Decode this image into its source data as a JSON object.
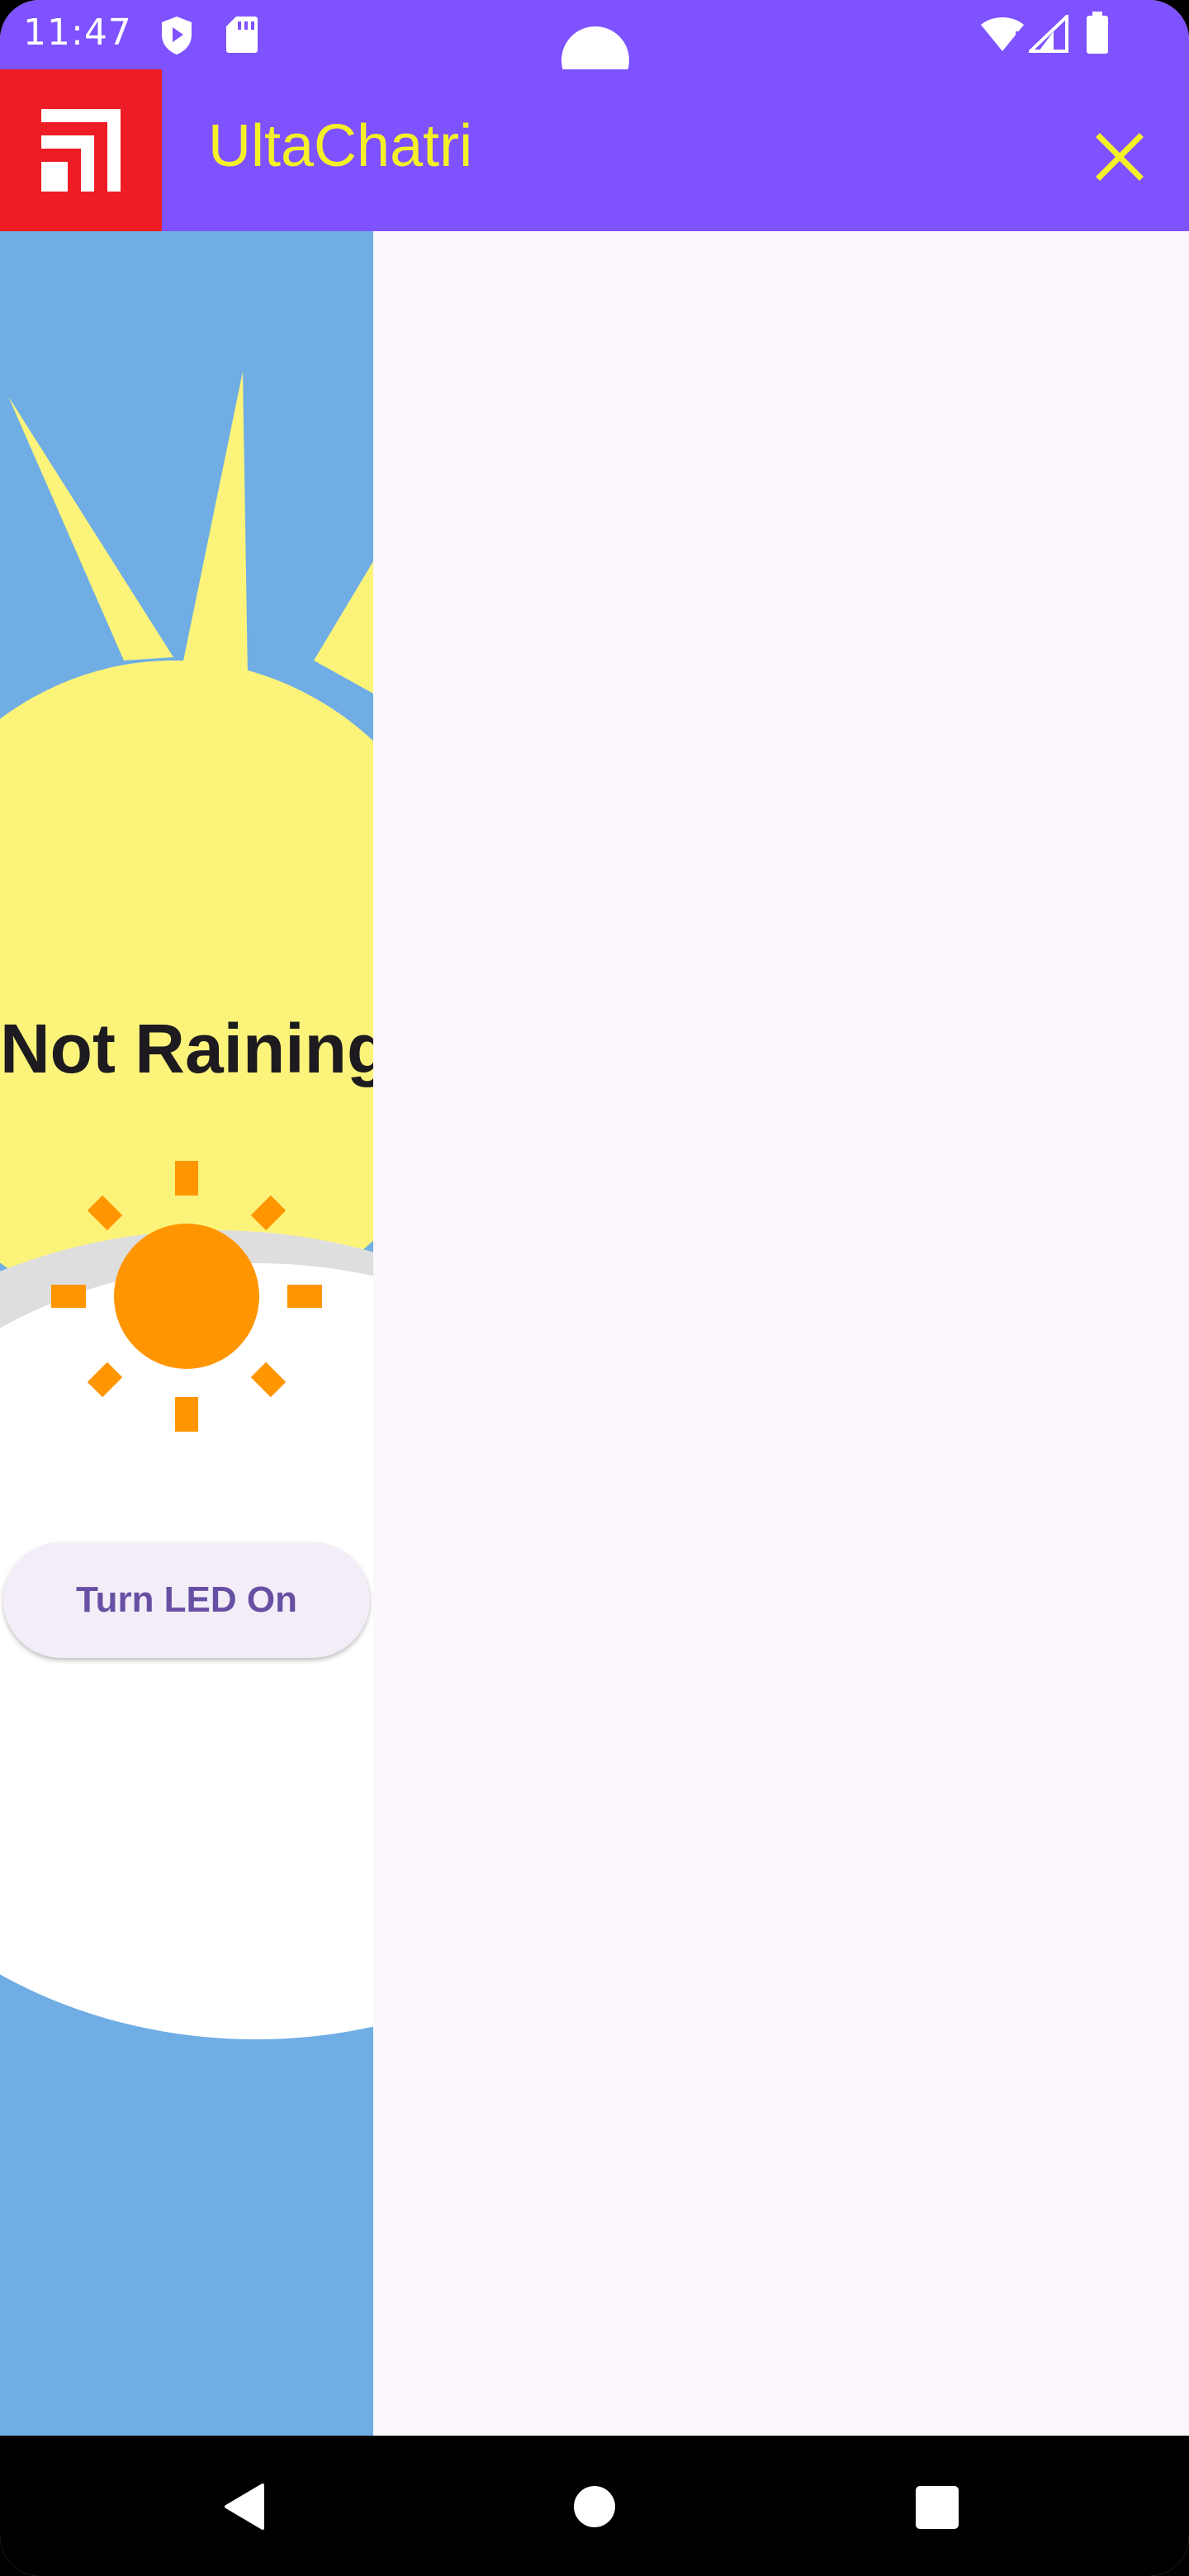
{
  "status_bar": {
    "time": "11:47",
    "background": "#7f52ff",
    "icons": [
      "shield-play-icon",
      "sd-card-icon",
      "wifi-icon",
      "signal-icon",
      "battery-icon"
    ]
  },
  "app_bar": {
    "title": "UltaChatri",
    "title_color": "#f4f028",
    "background": "#7f52ff",
    "logo_color": "#ee1c25",
    "close_icon": "close-icon"
  },
  "weather": {
    "status_text": "Not Raining",
    "icon": "sun-icon",
    "icon_color": "#ff9500",
    "button_label": "Turn LED On",
    "button_text_color": "#6750a4"
  },
  "nav_bar": {
    "icons": [
      "back-icon",
      "home-icon",
      "recents-icon"
    ]
  }
}
